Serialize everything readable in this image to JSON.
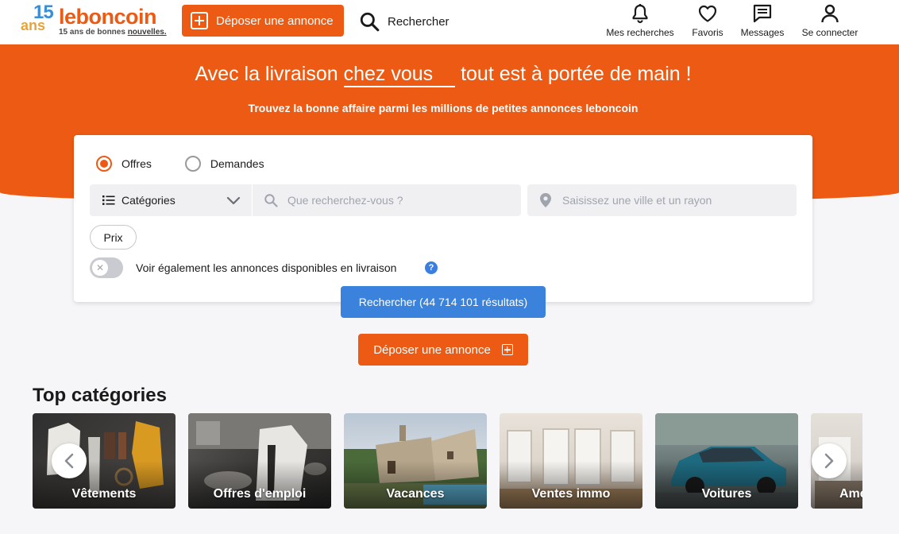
{
  "header": {
    "logo": {
      "number": "15",
      "ans": "ans",
      "word": "leboncoin",
      "tagline_prefix": "15 ans de bonnes ",
      "tagline_highlight": "nouvelles."
    },
    "depose_label": "Déposer une annonce",
    "search_label": "Rechercher",
    "nav": [
      {
        "label": "Mes recherches",
        "icon": "bell-icon"
      },
      {
        "label": "Favoris",
        "icon": "heart-icon"
      },
      {
        "label": "Messages",
        "icon": "message-icon"
      },
      {
        "label": "Se connecter",
        "icon": "user-icon"
      }
    ]
  },
  "hero": {
    "title_prefix": "Avec la livraison ",
    "title_highlight": "chez vous",
    "title_suffix": " tout est à portée de main !",
    "subtitle": "Trouvez la bonne affaire parmi les millions de petites annonces leboncoin"
  },
  "search": {
    "radio_options": [
      {
        "label": "Offres",
        "selected": true
      },
      {
        "label": "Demandes",
        "selected": false
      }
    ],
    "category_label": "Catégories",
    "query_placeholder": "Que recherchez-vous ?",
    "location_placeholder": "Saisissez une ville et un rayon",
    "price_label": "Prix",
    "delivery_toggle_label": "Voir également les annonces disponibles en livraison",
    "delivery_toggle_on": false,
    "help_symbol": "?",
    "search_button": "Rechercher (44 714 101 résultats)"
  },
  "depose_button": "Déposer une annonce",
  "top_categories": {
    "title": "Top catégories",
    "items": [
      {
        "label": "Vêtements"
      },
      {
        "label": "Offres d'emploi"
      },
      {
        "label": "Vacances"
      },
      {
        "label": "Ventes immo"
      },
      {
        "label": "Voitures"
      },
      {
        "label": "Ameublement"
      }
    ]
  },
  "colors": {
    "brand": "#ec5a13",
    "primary_blue": "#3a82db",
    "background": "#f6f6f8"
  }
}
